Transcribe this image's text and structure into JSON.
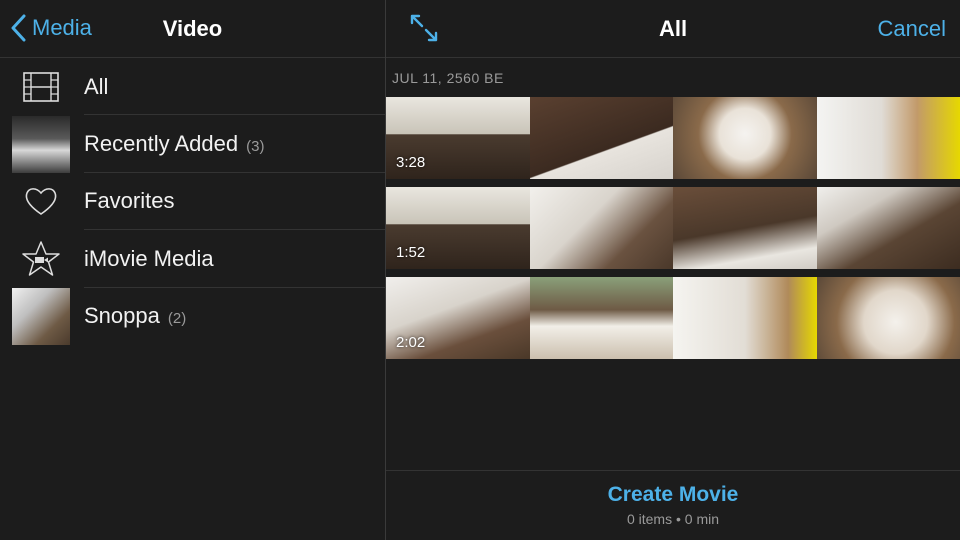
{
  "left": {
    "back_label": "Media",
    "title": "Video",
    "items": [
      {
        "label": "All",
        "count": ""
      },
      {
        "label": "Recently Added",
        "count": "(3)"
      },
      {
        "label": "Favorites",
        "count": ""
      },
      {
        "label": "iMovie Media",
        "count": ""
      },
      {
        "label": "Snoppa",
        "count": "(2)"
      }
    ]
  },
  "right": {
    "title": "All",
    "cancel_label": "Cancel",
    "date_header": "JUL 11, 2560 BE",
    "clips": [
      {
        "duration": "3:28"
      },
      {
        "duration": "1:52"
      },
      {
        "duration": "2:02"
      }
    ],
    "footer": {
      "create_label": "Create Movie",
      "items_text": "0 items",
      "bullet": "•",
      "min_text": "0 min"
    }
  },
  "colors": {
    "accent": "#4db1e8",
    "background": "#1c1c1c",
    "separator": "#333333",
    "secondary_text": "#9a9a9a"
  }
}
